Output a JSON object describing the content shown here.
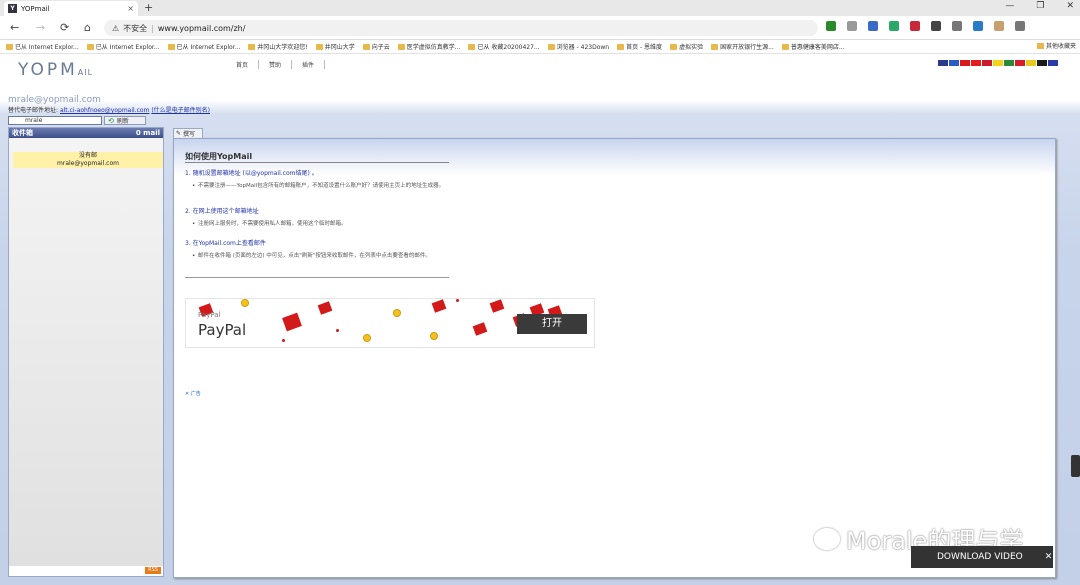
{
  "browser": {
    "tab_title": "YOPmail",
    "tab_close": "×",
    "new_tab": "+",
    "window_controls": [
      "—",
      "❐",
      "✕"
    ],
    "security_label": "不安全",
    "url": "www.yopmail.com/zh/",
    "nav_back": "←",
    "nav_forward": "→",
    "nav_reload": "⟳",
    "nav_home": "⌂",
    "bookmarks": [
      "已从 Internet Explor...",
      "已从 Internet Explor...",
      "已从 Internet Explor...",
      "井冈山大学欢迎您!",
      "井冈山大学",
      "向子云",
      "医学虚拟仿真教学...",
      "已从 收藏20200427...",
      "浏览器 - 423Down",
      "首页 - 恩维度",
      "虚拟实验",
      "国家开放银行生源...",
      "普惠健康客美网店..."
    ],
    "bookmark_other": "其他收藏夹",
    "extension_colors": [
      "#2a8a2a",
      "#999999",
      "#3a6ac8",
      "#2aa86a",
      "#c8283a",
      "#444444",
      "#777777",
      "#2a7ac8",
      "#c8a070",
      "#777777"
    ]
  },
  "site": {
    "logo": "YOPM",
    "logo_suffix": "AIL",
    "nav": [
      "首页",
      "赞助",
      "插件"
    ],
    "flag_colors": [
      "#2a3a8a",
      "#2a5ac8",
      "#d81a1a",
      "#e81a1a",
      "#c81a2a",
      "#f4d21a",
      "#2a8a3a",
      "#d81a2a",
      "#e8c81a",
      "#1a1a1a",
      "#2a3aa8"
    ],
    "email_display": "mrale@yopmail.com",
    "alt_text": "替代电子邮件地址:",
    "alt_address": "alt.ci-aohfnoeo@yopmail.com",
    "alt_link": "(什么是电子邮件别名)",
    "login_value": "mrale",
    "refresh_label": "刷新",
    "refresh_icon": "refresh-icon"
  },
  "inbox": {
    "title": "收件箱",
    "count": "0 mail",
    "no_mail": "没有邮",
    "no_mail_addr": "mrale@yopmail.com",
    "rss": "RSS"
  },
  "main": {
    "write_tab": "撰写",
    "how_title": "如何使用YopMail",
    "steps": [
      {
        "title": "1. 随机设置邮箱地址 (以@yopmail.com结尾) 。",
        "bullet": "不需要注册——YopMail包含所有的邮箱账户，不知道设置什么账户好？请使用主页上的地址生成器。"
      },
      {
        "title": "2. 在网上使用这个邮箱地址",
        "bullet": "注册网上服务时，不需要使用私人邮箱，使用这个临时邮箱。"
      },
      {
        "title": "3. 在YopMail.com上查看邮件",
        "bullet": "邮件在收件箱 (页面的左边) 中可见，点击\"刷新\"按钮来收取邮件，在列表中点击要查看的邮件。"
      }
    ],
    "ad": {
      "brand_small": "PayPal",
      "brand_big": "PayPal",
      "open": "打开",
      "ad_label": "✕ 广告"
    }
  },
  "overlays": {
    "watermark": "Morale的理与学",
    "download_video": "DOWNLOAD VIDEO",
    "download_close": "✕"
  }
}
